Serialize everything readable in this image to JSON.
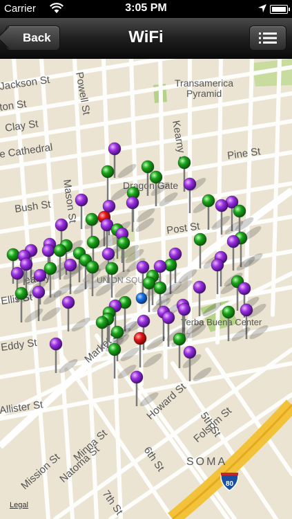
{
  "status_bar": {
    "carrier": "Carrier",
    "time": "3:05 PM"
  },
  "nav": {
    "back_label": "Back",
    "title": "WiFi"
  },
  "map": {
    "street_labels": [
      {
        "text": "Jackson St"
      },
      {
        "text": "ton St"
      },
      {
        "text": "Clay St"
      },
      {
        "text": "e Cathedral"
      },
      {
        "text": "Powell St"
      },
      {
        "text": "Transamerica"
      },
      {
        "text": "Pyramid"
      },
      {
        "text": "Kearny St"
      },
      {
        "text": "Pine St"
      },
      {
        "text": "Dragon Gate"
      },
      {
        "text": "Bush St"
      },
      {
        "text": "Mason St"
      },
      {
        "text": "Post St"
      },
      {
        "text": "Eddy St"
      },
      {
        "text": "Market St"
      },
      {
        "text": "Yerba Buena Center"
      },
      {
        "text": "Howard St"
      },
      {
        "text": "Allister St"
      },
      {
        "text": "Minna St"
      },
      {
        "text": "Natoma St"
      },
      {
        "text": "Folsom St"
      },
      {
        "text": "5th St"
      },
      {
        "text": "Mission St"
      },
      {
        "text": "6th St"
      },
      {
        "text": "SOMA"
      },
      {
        "text": "7th St"
      },
      {
        "text": "UNION SQUARE"
      },
      {
        "text": "Ellis St"
      },
      {
        "text": "earny"
      }
    ],
    "highway_shield": "80",
    "legal": "Legal",
    "pin_colors": {
      "purple": "#8a2be2",
      "green": "#1ea51e",
      "red": "#e01010",
      "blue": "#1a73e8"
    },
    "pins": [
      {
        "color": "purple"
      },
      {
        "color": "green"
      },
      {
        "color": "green"
      },
      {
        "color": "green"
      },
      {
        "color": "green"
      },
      {
        "color": "purple"
      },
      {
        "color": "green"
      },
      {
        "color": "purple"
      },
      {
        "color": "red"
      },
      {
        "color": "purple"
      },
      {
        "color": "purple"
      },
      {
        "color": "green"
      },
      {
        "color": "purple"
      },
      {
        "color": "green"
      },
      {
        "color": "purple"
      },
      {
        "color": "green"
      },
      {
        "color": "green"
      },
      {
        "color": "purple"
      },
      {
        "color": "green"
      },
      {
        "color": "purple"
      },
      {
        "color": "purple"
      },
      {
        "color": "green"
      },
      {
        "color": "green"
      },
      {
        "color": "purple"
      },
      {
        "color": "purple"
      },
      {
        "color": "green"
      },
      {
        "color": "green"
      },
      {
        "color": "purple"
      },
      {
        "color": "purple"
      },
      {
        "color": "purple"
      },
      {
        "color": "purple"
      },
      {
        "color": "green"
      },
      {
        "color": "green"
      },
      {
        "color": "green"
      },
      {
        "color": "purple"
      },
      {
        "color": "purple"
      },
      {
        "color": "purple"
      },
      {
        "color": "green"
      },
      {
        "color": "green"
      },
      {
        "color": "purple"
      },
      {
        "color": "green"
      },
      {
        "color": "green"
      },
      {
        "color": "purple"
      },
      {
        "color": "purple"
      },
      {
        "color": "green"
      },
      {
        "color": "purple"
      },
      {
        "color": "purple"
      },
      {
        "color": "green"
      },
      {
        "color": "green"
      },
      {
        "color": "blue"
      },
      {
        "color": "green"
      },
      {
        "color": "purple"
      },
      {
        "color": "purple"
      },
      {
        "color": "green"
      },
      {
        "color": "purple"
      },
      {
        "color": "purple"
      },
      {
        "color": "purple"
      },
      {
        "color": "green"
      },
      {
        "color": "purple"
      },
      {
        "color": "green"
      },
      {
        "color": "purple"
      },
      {
        "color": "red"
      },
      {
        "color": "green"
      },
      {
        "color": "green"
      },
      {
        "color": "green"
      },
      {
        "color": "green"
      },
      {
        "color": "purple"
      },
      {
        "color": "purple"
      },
      {
        "color": "purple"
      },
      {
        "color": "purple"
      },
      {
        "color": "green"
      },
      {
        "color": "green"
      },
      {
        "color": "purple"
      },
      {
        "color": "purple"
      },
      {
        "color": "green"
      },
      {
        "color": "purple"
      },
      {
        "color": "purple"
      }
    ]
  }
}
